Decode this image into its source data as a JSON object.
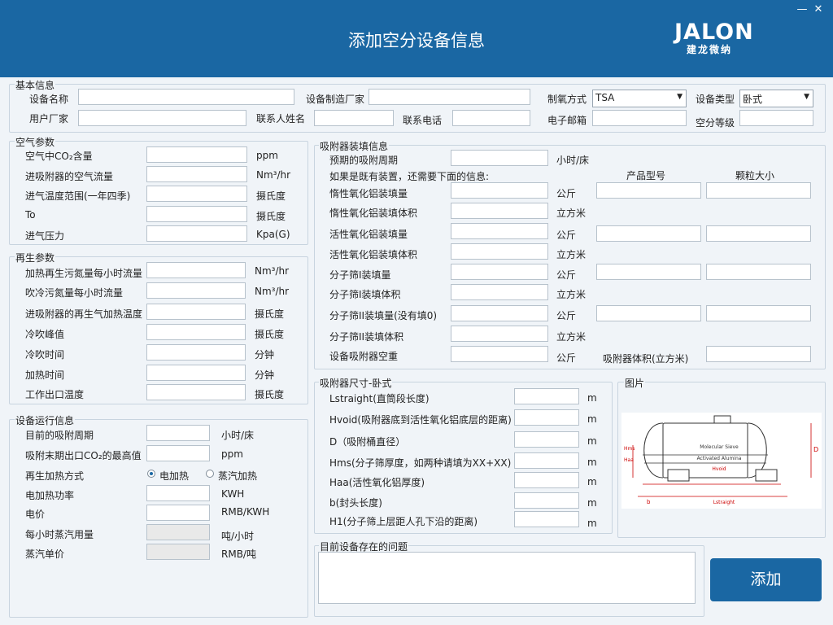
{
  "window": {
    "title": "添加空分设备信息",
    "logo": "JALON",
    "logo_sub": "建龙微纳",
    "min": "—",
    "close": "✕"
  },
  "basic": {
    "title": "基本信息",
    "device_name": "设备名称",
    "manufacturer": "设备制造厂家",
    "oxygen_method": "制氧方式",
    "oxygen_method_value": "TSA",
    "device_type": "设备类型",
    "device_type_value": "卧式",
    "user_factory": "用户厂家",
    "contact_name": "联系人姓名",
    "contact_phone": "联系电话",
    "email": "电子邮箱",
    "air_grade": "空分等级"
  },
  "air": {
    "title": "空气参数",
    "rows": [
      {
        "label": "空气中CO₂含量",
        "unit": "ppm"
      },
      {
        "label": "进吸附器的空气流量",
        "unit": "Nm³/hr"
      },
      {
        "label": "进气温度范围(一年四季)",
        "unit": "摄氏度"
      },
      {
        "label": "To",
        "unit": "摄氏度"
      },
      {
        "label": "进气压力",
        "unit": "Kpa(G)"
      }
    ]
  },
  "regen": {
    "title": "再生参数",
    "rows": [
      {
        "label": "加热再生污氮量每小时流量",
        "unit": "Nm³/hr"
      },
      {
        "label": "吹冷污氮量每小时流量",
        "unit": "Nm³/hr"
      },
      {
        "label": "进吸附器的再生气加热温度",
        "unit": "摄氏度"
      },
      {
        "label": "冷吹峰值",
        "unit": "摄氏度"
      },
      {
        "label": "冷吹时间",
        "unit": "分钟"
      },
      {
        "label": "加热时间",
        "unit": "分钟"
      },
      {
        "label": "工作出口温度",
        "unit": "摄氏度"
      }
    ]
  },
  "run": {
    "title": "设备运行信息",
    "cycle": "目前的吸附周期",
    "cycle_unit": "小时/床",
    "co2_max": "吸附末期出口CO₂的最高值",
    "co2_unit": "ppm",
    "heat_mode": "再生加热方式",
    "heat_electric": "电加热",
    "heat_steam": "蒸汽加热",
    "power": "电加热功率",
    "power_unit": "KWH",
    "price": "电价",
    "price_unit": "RMB/KWH",
    "steam_per_hour": "每小时蒸汽用量",
    "steam_unit": "吨/小时",
    "steam_price": "蒸汽单价",
    "steam_price_unit": "RMB/吨"
  },
  "fill": {
    "title": "吸附器装填信息",
    "expected_cycle": "预期的吸附周期",
    "expected_cycle_unit": "小时/床",
    "existing_note": "如果是既有装置，还需要下面的信息:",
    "col_model": "产品型号",
    "col_size": "颗粒大小",
    "rows": [
      {
        "label": "惰性氧化铝装填量",
        "unit": "公斤"
      },
      {
        "label": "惰性氧化铝装填体积",
        "unit": "立方米"
      },
      {
        "label": "活性氧化铝装填量",
        "unit": "公斤"
      },
      {
        "label": "活性氧化铝装填体积",
        "unit": "立方米"
      },
      {
        "label": "分子筛I装填量",
        "unit": "公斤"
      },
      {
        "label": "分子筛I装填体积",
        "unit": "立方米"
      },
      {
        "label": "分子筛II装填量(没有填0)",
        "unit": "公斤"
      },
      {
        "label": "分子筛II装填体积",
        "unit": "立方米"
      },
      {
        "label": "设备吸附器空重",
        "unit": "公斤"
      }
    ],
    "adsorber_volume": "吸附器体积(立方米)"
  },
  "size": {
    "title": "吸附器尺寸-卧式",
    "rows": [
      {
        "label": "Lstraight(直筒段长度)",
        "unit": "m"
      },
      {
        "label": "Hvoid(吸附器底到活性氧化铝底层的距离)",
        "unit": "m"
      },
      {
        "label": "D（吸附桶直径）",
        "unit": "m"
      },
      {
        "label": "Hms(分子筛厚度，如两种请填为XX+XX)",
        "unit": "m"
      },
      {
        "label": "Haa(活性氧化铝厚度)",
        "unit": "m"
      },
      {
        "label": "b(封头长度)",
        "unit": "m"
      },
      {
        "label": "H1(分子筛上层距人孔下沿的距离)",
        "unit": "m"
      }
    ]
  },
  "picture": {
    "title": "图片",
    "labels": {
      "ms": "Molecular Sieve",
      "aa": "Activated Alumina",
      "hvoid": "Hvoid",
      "d": "D",
      "b": "b",
      "lstraight": "Lstraight",
      "hms": "Hms",
      "haa": "Haa"
    }
  },
  "problem": {
    "title": "目前设备存在的问题"
  },
  "add_button": "添加",
  "colors": {
    "brand": "#1a67a3"
  }
}
